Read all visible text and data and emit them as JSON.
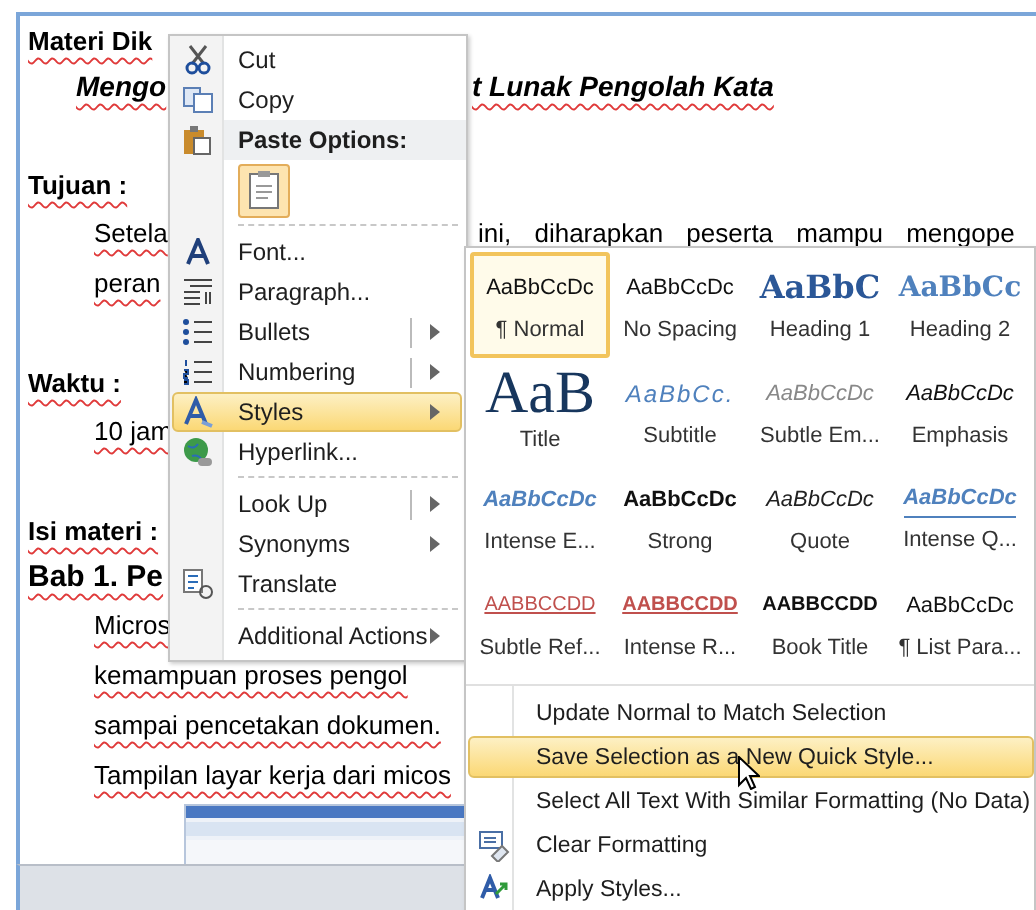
{
  "document": {
    "lines": [
      {
        "kind": "section",
        "left": "Materi Dik"
      },
      {
        "kind": "subtitle",
        "left": "Mengo",
        "right": "t Lunak Pengolah Kata"
      },
      {
        "kind": "section",
        "left": "Tujuan :"
      },
      {
        "kind": "body",
        "left": "Setela",
        "right": "ini, diharapkan peserta mampu mengope"
      },
      {
        "kind": "body",
        "left": "peran"
      },
      {
        "kind": "section",
        "left": "Waktu :"
      },
      {
        "kind": "body",
        "left": "10 jam"
      },
      {
        "kind": "section",
        "left": "Isi materi :"
      },
      {
        "kind": "chapter",
        "left": "Bab 1. Pe"
      },
      {
        "kind": "body",
        "left": "Micros"
      },
      {
        "kind": "body",
        "left": "kemampuan proses pengol"
      },
      {
        "kind": "body",
        "left": "sampai pencetakan dokumen."
      },
      {
        "kind": "body",
        "left": "Tampilan layar kerja dari micos"
      }
    ]
  },
  "context_menu": {
    "items": [
      {
        "kind": "command",
        "label": "Cut",
        "selected": false,
        "submenu": false,
        "split": false
      },
      {
        "kind": "command",
        "label": "Copy",
        "selected": false,
        "submenu": false,
        "split": false
      },
      {
        "kind": "header",
        "label": "Paste Options:"
      },
      {
        "kind": "paste-options"
      },
      {
        "kind": "separator"
      },
      {
        "kind": "command",
        "label": "Font...",
        "selected": false,
        "submenu": false,
        "split": false
      },
      {
        "kind": "command",
        "label": "Paragraph...",
        "selected": false,
        "submenu": false,
        "split": false
      },
      {
        "kind": "command",
        "label": "Bullets",
        "selected": false,
        "submenu": true,
        "split": true
      },
      {
        "kind": "command",
        "label": "Numbering",
        "selected": false,
        "submenu": true,
        "split": true
      },
      {
        "kind": "command",
        "label": "Styles",
        "selected": true,
        "submenu": true,
        "split": false
      },
      {
        "kind": "command",
        "label": "Hyperlink...",
        "selected": false,
        "submenu": false,
        "split": false
      },
      {
        "kind": "separator"
      },
      {
        "kind": "command",
        "label": "Look Up",
        "selected": false,
        "submenu": true,
        "split": true
      },
      {
        "kind": "command",
        "label": "Synonyms",
        "selected": false,
        "submenu": true,
        "split": false
      },
      {
        "kind": "command",
        "label": "Translate",
        "selected": false,
        "submenu": false,
        "split": false
      },
      {
        "kind": "separator"
      },
      {
        "kind": "command",
        "label": "Additional Actions",
        "selected": false,
        "submenu": true,
        "split": false
      }
    ]
  },
  "styles_submenu": {
    "gallery": [
      {
        "kind": "normal",
        "preview": "AaBbCcDc",
        "name": "¶ Normal",
        "selected": true
      },
      {
        "kind": "no-spacing",
        "preview": "AaBbCcDc",
        "name": "No Spacing",
        "selected": false
      },
      {
        "kind": "heading1",
        "preview": "AaBbC",
        "name": "Heading 1",
        "selected": false
      },
      {
        "kind": "heading2",
        "preview": "AaBbCc",
        "name": "Heading 2",
        "selected": false
      },
      {
        "kind": "title",
        "preview": "AaB",
        "name": "Title",
        "selected": false
      },
      {
        "kind": "subtitle",
        "preview": "AaBbCc.",
        "name": "Subtitle",
        "selected": false
      },
      {
        "kind": "subtle-emphasis",
        "preview": "AaBbCcDc",
        "name": "Subtle Em...",
        "selected": false
      },
      {
        "kind": "emphasis",
        "preview": "AaBbCcDc",
        "name": "Emphasis",
        "selected": false
      },
      {
        "kind": "intense-emphasis",
        "preview": "AaBbCcDc",
        "name": "Intense E...",
        "selected": false
      },
      {
        "kind": "strong",
        "preview": "AaBbCcDc",
        "name": "Strong",
        "selected": false
      },
      {
        "kind": "quote",
        "preview": "AaBbCcDc",
        "name": "Quote",
        "selected": false
      },
      {
        "kind": "intense-quote",
        "preview": "AaBbCcDc",
        "name": "Intense Q...",
        "selected": false
      },
      {
        "kind": "subtle-reference",
        "preview": "AABBCCDD",
        "name": "Subtle Ref...",
        "selected": false
      },
      {
        "kind": "intense-reference",
        "preview": "AABBCCDD",
        "name": "Intense R...",
        "selected": false
      },
      {
        "kind": "book-title",
        "preview": "AABBCCDD",
        "name": "Book Title",
        "selected": false
      },
      {
        "kind": "list-paragraph",
        "preview": "AaBbCcDc",
        "name": "¶ List Para...",
        "selected": false
      }
    ],
    "commands": [
      {
        "label": "Update Normal to Match Selection",
        "selected": false
      },
      {
        "label": "Save Selection as a New Quick Style...",
        "selected": true
      },
      {
        "label": "Select All Text With Similar Formatting (No Data)",
        "selected": false
      },
      {
        "label": "Clear Formatting",
        "selected": false
      },
      {
        "label": "Apply Styles...",
        "selected": false
      }
    ]
  }
}
